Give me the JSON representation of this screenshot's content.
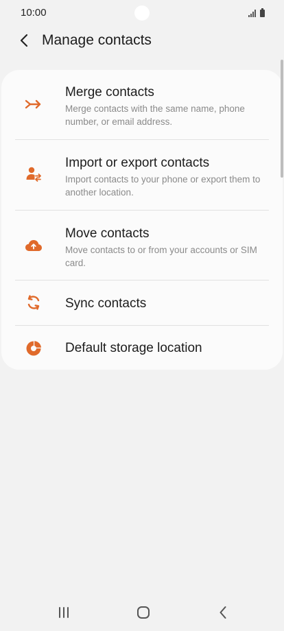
{
  "status_bar": {
    "time": "10:00"
  },
  "header": {
    "title": "Manage contacts",
    "back_icon": "chevron-left-icon"
  },
  "accent_color": "#e06a2b",
  "menu": {
    "items": [
      {
        "title": "Merge contacts",
        "description": "Merge contacts with the same name, phone number, or email address.",
        "icon": "merge-icon"
      },
      {
        "title": "Import or export contacts",
        "description": "Import contacts to your phone or export them to another location.",
        "icon": "person-transfer-icon"
      },
      {
        "title": "Move contacts",
        "description": "Move contacts to or from your accounts or SIM card.",
        "icon": "cloud-upload-icon"
      },
      {
        "title": "Sync contacts",
        "icon": "sync-icon"
      },
      {
        "title": "Default storage location",
        "icon": "storage-pie-icon"
      }
    ]
  },
  "nav_bar": {
    "recents_icon": "recents-icon",
    "home_icon": "home-icon",
    "back_icon": "back-icon"
  }
}
